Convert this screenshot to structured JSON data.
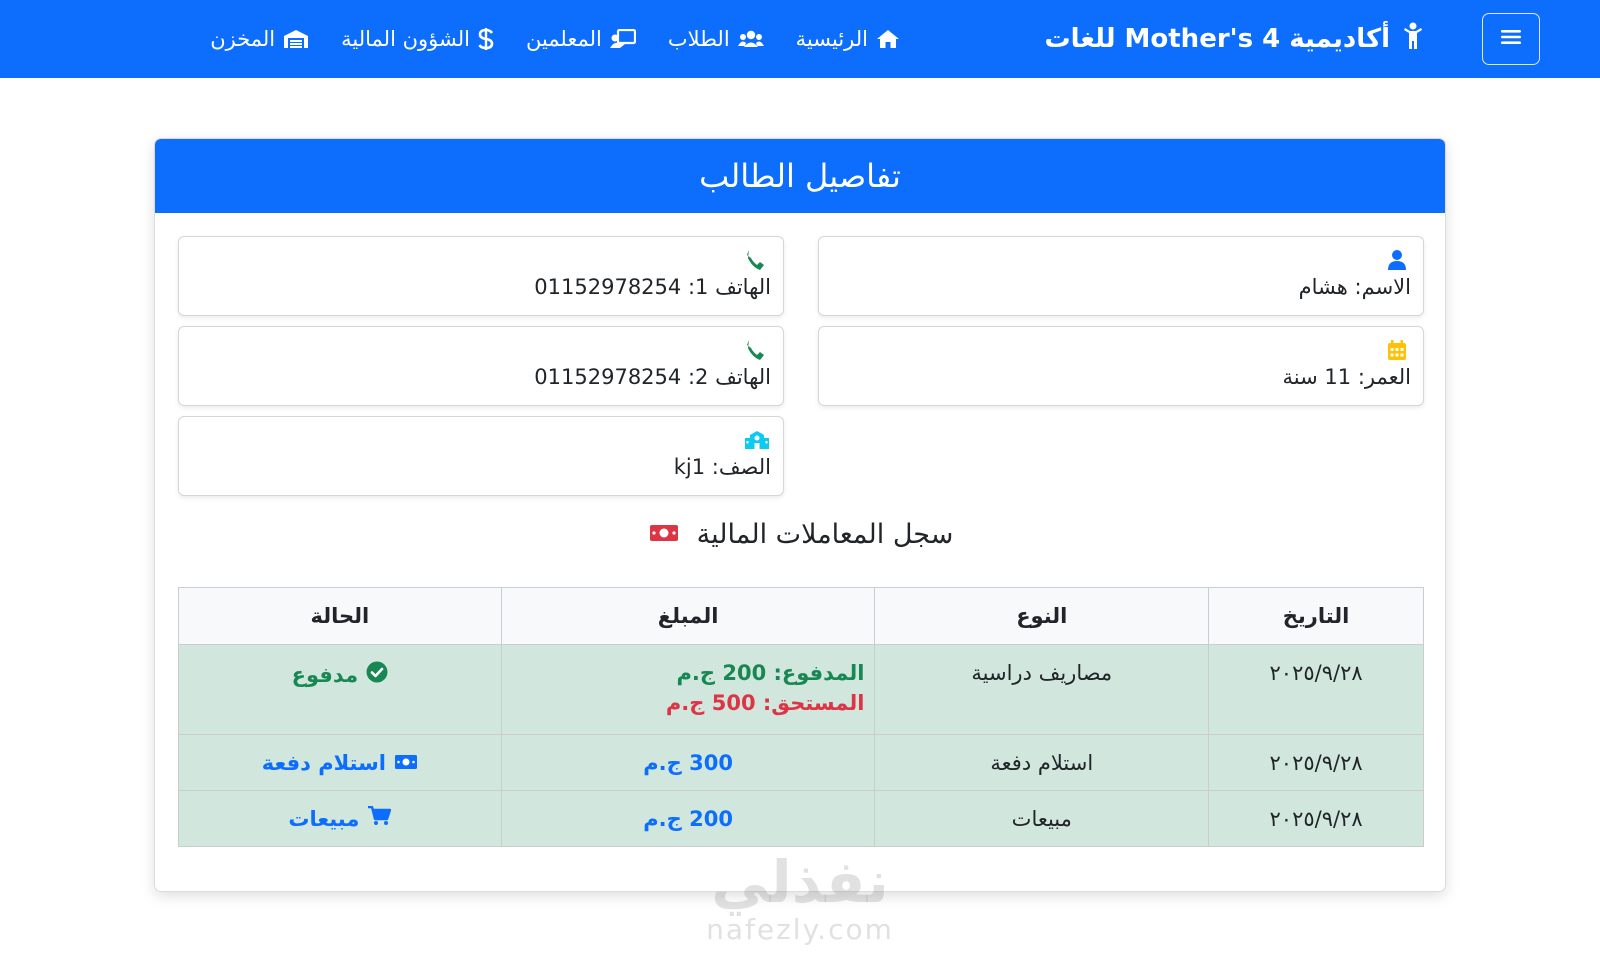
{
  "nav": {
    "brand": "أكاديمية Mother's 4 للغات",
    "links": [
      {
        "label": "الرئيسية",
        "icon": "home-icon"
      },
      {
        "label": "الطلاب",
        "icon": "users-icon"
      },
      {
        "label": "المعلمين",
        "icon": "chalkboard-teacher-icon"
      },
      {
        "label": "الشؤون المالية",
        "icon": "dollar-icon"
      },
      {
        "label": "المخزن",
        "icon": "warehouse-icon"
      }
    ]
  },
  "colors": {
    "primary": "#0d6efd",
    "success": "#198754",
    "danger": "#dc3545",
    "warning": "#ffc107",
    "info": "#0dcaf0",
    "row_bg": "#d1e7dd"
  },
  "card": {
    "title": "تفاصيل الطالب",
    "fields": {
      "name": "الاسم: هشام",
      "age": "العمر: 11 سنة",
      "phone1": "الهاتف 1: 01152978254",
      "phone2": "الهاتف 2: 01152978254",
      "class": "الصف: kj1"
    }
  },
  "transactions": {
    "title": "سجل المعاملات المالية",
    "columns": [
      "التاريخ",
      "النوع",
      "المبلغ",
      "الحالة"
    ],
    "rows": [
      {
        "date": "٢٠٢٥/٩/٢٨",
        "type": "مصاريف دراسية",
        "paid": "المدفوع: 200 ج.م",
        "due": "المستحق: 500 ج.م",
        "status": "مدفوع"
      },
      {
        "date": "٢٠٢٥/٩/٢٨",
        "type": "استلام دفعة",
        "amount": "300 ج.م",
        "status": "استلام دفعة"
      },
      {
        "date": "٢٠٢٥/٩/٢٨",
        "type": "مبيعات",
        "amount": "200 ج.م",
        "status": "مبيعات"
      }
    ]
  },
  "watermark": {
    "arabic": "نفذلي",
    "latin": "nafezly.com"
  }
}
